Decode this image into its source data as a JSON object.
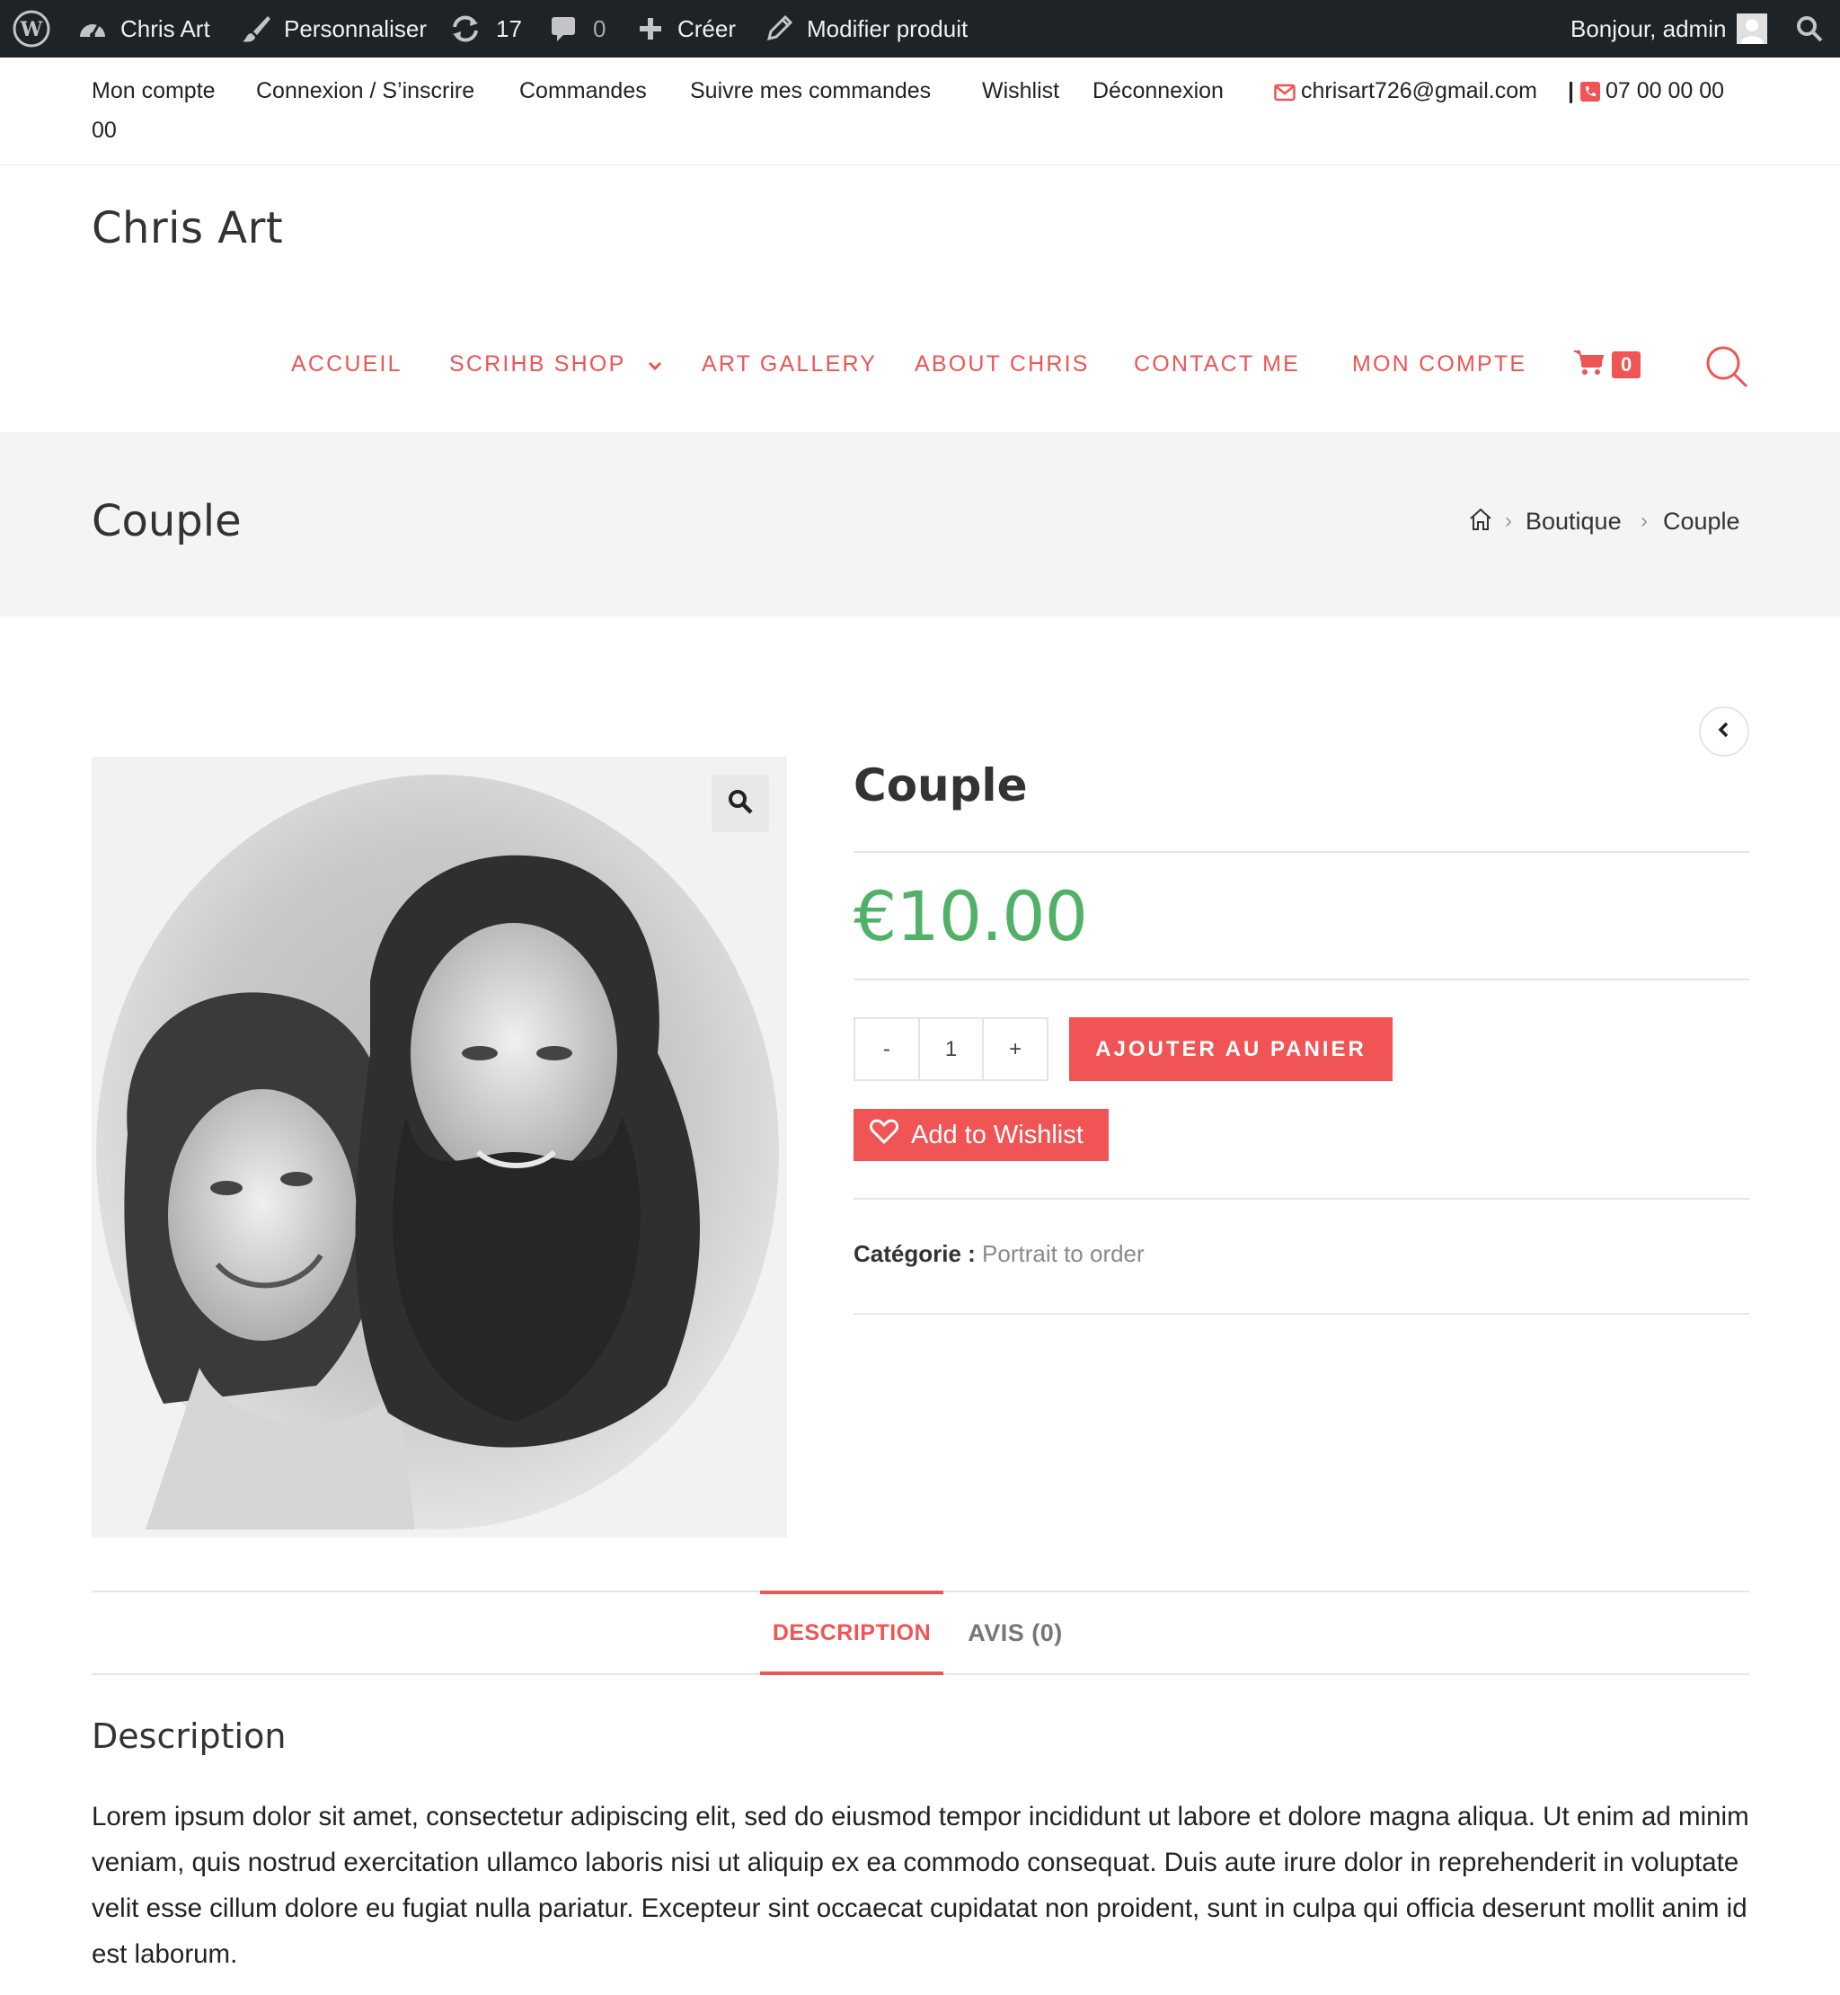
{
  "admin_bar": {
    "site_name": "Chris Art",
    "customize": "Personnaliser",
    "updates_count": "17",
    "comments_count": "0",
    "new": "Créer",
    "edit_product": "Modifier produit",
    "greeting": "Bonjour, admin"
  },
  "top_bar": {
    "links": [
      "Mon compte",
      "Connexion / S’inscrire",
      "Commandes",
      "Suivre mes commandes",
      "Wishlist",
      "Déconnexion"
    ],
    "email": "chrisart726@gmail.com",
    "separator": "|",
    "phone_part1": "07 00 00 00",
    "phone_part2": "00"
  },
  "header": {
    "site_title": "Chris Art",
    "nav": [
      "ACCUEIL",
      "SCRIHB SHOP",
      "ART GALLERY",
      "ABOUT CHRIS",
      "CONTACT ME",
      "MON COMPTE"
    ],
    "cart_count": "0"
  },
  "page_header": {
    "title": "Couple",
    "breadcrumb": [
      "Boutique",
      "Couple"
    ]
  },
  "product": {
    "title": "Couple",
    "price": "€10.00",
    "qty_minus": "-",
    "quantity": "1",
    "qty_plus": "+",
    "add_to_cart": "AJOUTER AU PANIER",
    "wishlist": "Add to Wishlist",
    "category_label": "Catégorie :",
    "category_value": "Portrait to order"
  },
  "tabs": {
    "description": "DESCRIPTION",
    "reviews": "AVIS (0)"
  },
  "description": {
    "heading": "Description",
    "body": "Lorem ipsum dolor sit amet, consectetur adipiscing elit, sed do eiusmod tempor incididunt ut labore et dolore magna aliqua. Ut enim ad minim veniam, quis nostrud exercitation ullamco laboris nisi ut aliquip ex ea commodo consequat. Duis aute irure dolor in reprehenderit in voluptate velit esse cillum dolore eu fugiat nulla pariatur. Excepteur sint occaecat cupidatat non proident, sunt in culpa qui officia deserunt mollit anim id est laborum."
  },
  "colors": {
    "accent": "#f05454",
    "price": "#52b168",
    "admin_bar": "#1d2327"
  },
  "icons": [
    "wordpress-logo-icon",
    "dashboard-icon",
    "brush-icon",
    "updates-icon",
    "comment-icon",
    "plus-icon",
    "pencil-icon",
    "avatar-icon",
    "search-icon",
    "envelope-icon",
    "phone-icon",
    "chevron-down-icon",
    "cart-icon",
    "home-icon",
    "chevron-left-icon",
    "zoom-icon",
    "heart-icon"
  ]
}
